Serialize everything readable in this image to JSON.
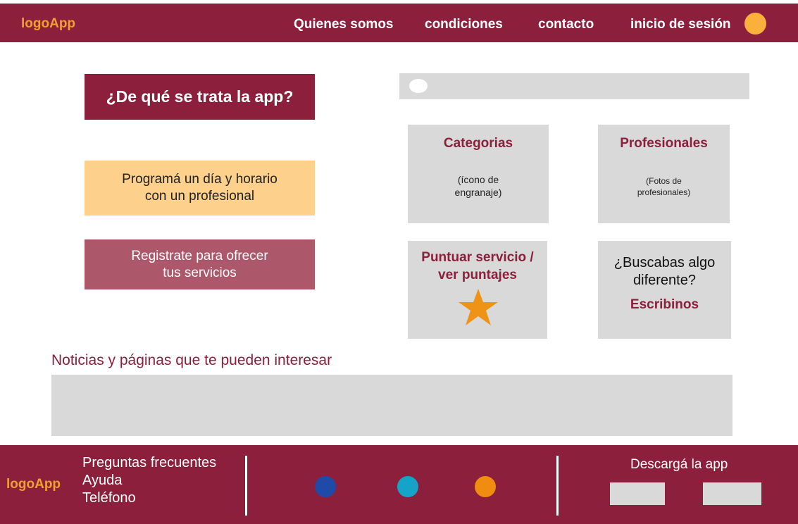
{
  "header": {
    "logo": "logoApp",
    "nav": [
      "Quienes somos",
      "condiciones",
      "contacto",
      "inicio de sesión"
    ]
  },
  "hero": {
    "title": "¿De qué se trata la app?",
    "schedule_line1": "Programá un día y  horario",
    "schedule_line2": "con un profesional",
    "register_line1": "Registrate para ofrecer",
    "register_line2": "tus servicios"
  },
  "tiles": {
    "categorias_title": "Categorias",
    "categorias_sub1": "(ícono de",
    "categorias_sub2": "engranaje)",
    "profesionales_title": "Profesionales",
    "profesionales_sub1": "(Fotos de",
    "profesionales_sub2": "profesionales)",
    "puntuar_line1": "Puntuar servicio /",
    "puntuar_line2": "ver puntajes",
    "buscabas_line1": "¿Buscabas algo",
    "buscabas_line2": "diferente?",
    "buscabas_link": "Escribinos"
  },
  "news": {
    "heading": "Noticias y páginas que te pueden interesar"
  },
  "footer": {
    "logo": "logoApp",
    "links": [
      "Preguntas frecuentes",
      "Ayuda",
      "Teléfono"
    ],
    "download": "Descargá la app"
  },
  "colors": {
    "brand": "#8c1f3c",
    "accent": "#f0a030",
    "social_1": "#1f4aa8",
    "social_2": "#16a3c8",
    "social_3": "#f08c10"
  },
  "icons": [
    "user-avatar-icon",
    "search-toggle-icon",
    "star-icon",
    "social-icon-1",
    "social-icon-2",
    "social-icon-3"
  ]
}
